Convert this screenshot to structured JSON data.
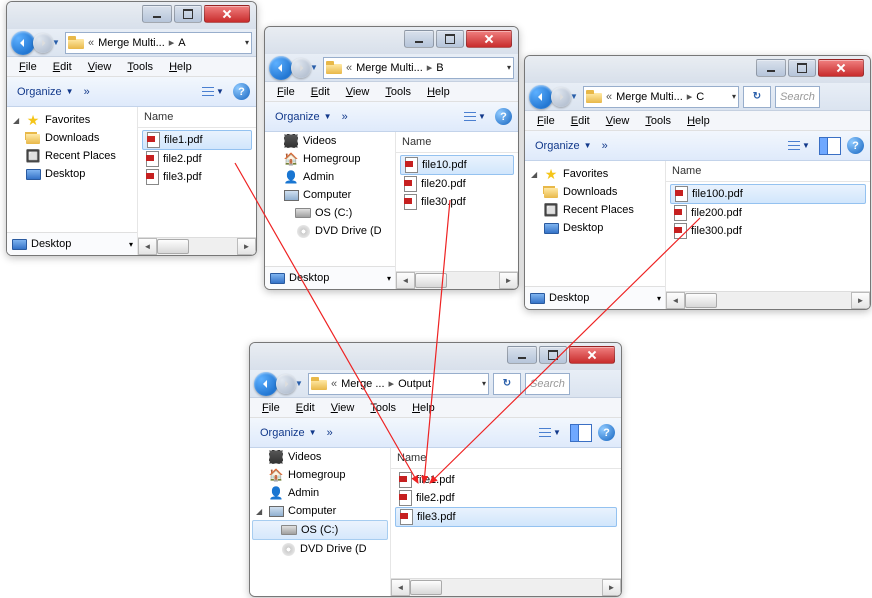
{
  "menu": {
    "file": "File",
    "edit": "Edit",
    "view": "View",
    "tools": "Tools",
    "help": "Help"
  },
  "toolbar": {
    "organize": "Organize",
    "chevron": "»"
  },
  "column": {
    "name": "Name"
  },
  "search_placeholder": "Search",
  "nav": {
    "favorites": "Favorites",
    "downloads": "Downloads",
    "recent": "Recent Places",
    "desktop": "Desktop",
    "videos": "Videos",
    "homegroup": "Homegroup",
    "admin": "Admin",
    "computer": "Computer",
    "os": "OS (C:)",
    "dvd": "DVD Drive (D"
  },
  "winA": {
    "crumb_root": "Merge Multi...",
    "crumb_leaf": "A",
    "files": [
      "file1.pdf",
      "file2.pdf",
      "file3.pdf"
    ]
  },
  "winB": {
    "crumb_root": "Merge Multi...",
    "crumb_leaf": "B",
    "files": [
      "file10.pdf",
      "file20.pdf",
      "file30.pdf"
    ]
  },
  "winC": {
    "crumb_root": "Merge Multi...",
    "crumb_leaf": "C",
    "files": [
      "file100.pdf",
      "file200.pdf",
      "file300.pdf"
    ]
  },
  "winOut": {
    "crumb_root": "Merge ...",
    "crumb_leaf": "Output",
    "files": [
      "file1.pdf",
      "file2.pdf",
      "file3.pdf"
    ]
  }
}
